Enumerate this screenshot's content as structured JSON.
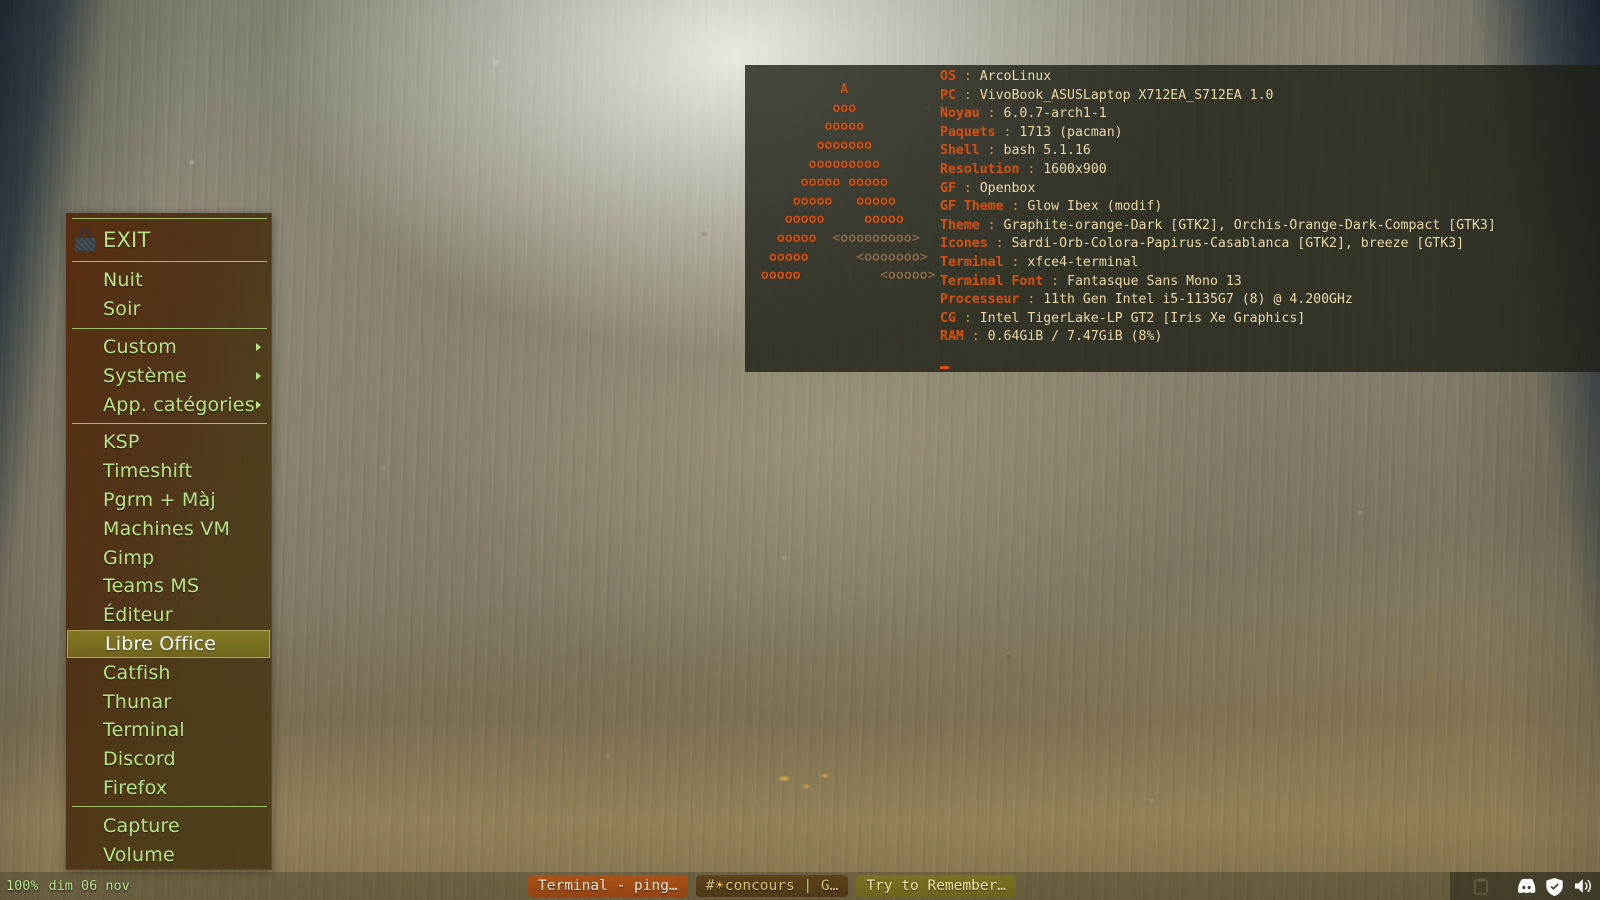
{
  "desktop": {
    "wallpaper_name": "rain-on-glass-wallpaper",
    "accent_orange": "#d8500f",
    "menu_text_green": "#b5e388",
    "menu_bg": "#4a280e"
  },
  "root_menu": {
    "title": "openbox-root-menu",
    "groups": [
      {
        "items": [
          {
            "label": "EXIT",
            "icon": "lock-icon",
            "submenu": false,
            "selected": false
          }
        ]
      },
      {
        "items": [
          {
            "label": "Nuit",
            "icon": null,
            "submenu": false,
            "selected": false
          },
          {
            "label": "Soir",
            "icon": null,
            "submenu": false,
            "selected": false
          }
        ]
      },
      {
        "items": [
          {
            "label": "Custom",
            "icon": null,
            "submenu": true,
            "selected": false
          },
          {
            "label": "Système",
            "icon": null,
            "submenu": true,
            "selected": false
          },
          {
            "label": "App. catégories",
            "icon": null,
            "submenu": true,
            "selected": false
          }
        ]
      },
      {
        "items": [
          {
            "label": "KSP",
            "icon": null,
            "submenu": false,
            "selected": false
          },
          {
            "label": "Timeshift",
            "icon": null,
            "submenu": false,
            "selected": false
          },
          {
            "label": "Pgrm + Màj",
            "icon": null,
            "submenu": false,
            "selected": false
          },
          {
            "label": "Machines VM",
            "icon": null,
            "submenu": false,
            "selected": false
          },
          {
            "label": "Gimp",
            "icon": null,
            "submenu": false,
            "selected": false
          },
          {
            "label": "Teams MS",
            "icon": null,
            "submenu": false,
            "selected": false
          },
          {
            "label": "Éditeur",
            "icon": null,
            "submenu": false,
            "selected": false
          },
          {
            "label": "Libre Office",
            "icon": null,
            "submenu": false,
            "selected": true
          },
          {
            "label": "Catfish",
            "icon": null,
            "submenu": false,
            "selected": false
          },
          {
            "label": "Thunar",
            "icon": null,
            "submenu": false,
            "selected": false
          },
          {
            "label": "Terminal",
            "icon": null,
            "submenu": false,
            "selected": false
          },
          {
            "label": "Discord",
            "icon": null,
            "submenu": false,
            "selected": false
          },
          {
            "label": "Firefox",
            "icon": null,
            "submenu": false,
            "selected": false
          }
        ]
      },
      {
        "items": [
          {
            "label": "Capture",
            "icon": null,
            "submenu": false,
            "selected": false
          },
          {
            "label": "Volume",
            "icon": null,
            "submenu": false,
            "selected": false
          }
        ]
      }
    ]
  },
  "terminal": {
    "app": "xfce4-terminal",
    "ascii_art": "            A\n           ooo\n          ooooo\n         ooooooo\n        ooooooooo\n       ooooo ooooo\n      ooooo   ooooo\n     ooooo     ooooo\n    ooooo  <ooooooooo>\n   ooooo      <ooooooo>\n  ooooo          <ooooo>",
    "neofetch": [
      {
        "key": "OS",
        "value": "ArcoLinux"
      },
      {
        "key": "PC",
        "value": "VivoBook_ASUSLaptop X712EA_S712EA 1.0"
      },
      {
        "key": "Noyau",
        "value": "6.0.7-arch1-1"
      },
      {
        "key": "Paquets",
        "value": "1713 (pacman)"
      },
      {
        "key": "Shell",
        "value": "bash 5.1.16"
      },
      {
        "key": "Resolution",
        "value": "1600x900"
      },
      {
        "key": "GF",
        "value": "Openbox"
      },
      {
        "key": "GF Theme",
        "value": "Glow Ibex (modif)"
      },
      {
        "key": "Theme",
        "value": "Graphite-orange-Dark [GTK2], Orchis-Orange-Dark-Compact [GTK3]"
      },
      {
        "key": "Icones",
        "value": "Sardi-Orb-Colora-Papirus-Casablanca [GTK2], breeze [GTK3]"
      },
      {
        "key": "Terminal",
        "value": "xfce4-terminal"
      },
      {
        "key": "Terminal Font",
        "value": "Fantasque Sans Mono 13"
      },
      {
        "key": "Processeur",
        "value": "11th Gen Intel i5-1135G7 (8) @ 4.200GHz"
      },
      {
        "key": "CG",
        "value": "Intel TigerLake-LP GT2 [Iris Xe Graphics]"
      },
      {
        "key": "RAM",
        "value": "0.64GiB / 7.47GiB (8%)"
      }
    ]
  },
  "taskbar": {
    "battery": "100%",
    "clock": "dim 06 nov",
    "tasks": [
      {
        "label": "Terminal - ping…",
        "state": "active"
      },
      {
        "label": "#",
        "star": "☀",
        "label2": "concours  |  G…",
        "state": "inactive-dark"
      },
      {
        "label": "Try to Remember…",
        "state": "inactive-olive"
      }
    ],
    "tray": [
      {
        "name": "discord-icon"
      },
      {
        "name": "shield-check-icon"
      },
      {
        "name": "volume-icon"
      }
    ]
  }
}
